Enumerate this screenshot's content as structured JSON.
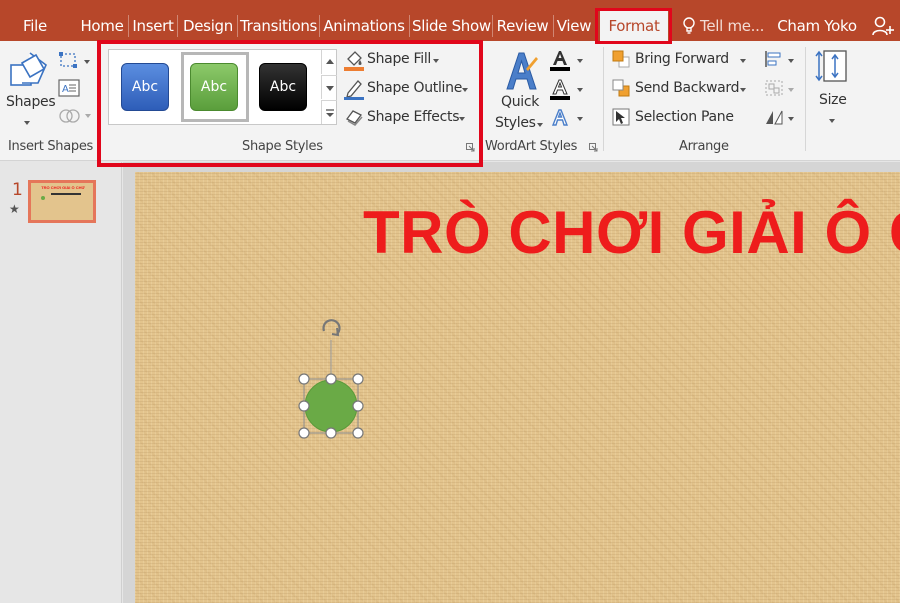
{
  "tabs": {
    "file": "File",
    "home": "Home",
    "insert": "Insert",
    "design": "Design",
    "transitions": "Transitions",
    "animations": "Animations",
    "slide_show": "Slide Show",
    "review": "Review",
    "view": "View",
    "format": "Format",
    "tell_me": "Tell me...",
    "user": "Cham Yoko"
  },
  "ribbon": {
    "insert_shapes": {
      "shapes_label": "Shapes",
      "group_label": "Insert Shapes"
    },
    "shape_styles": {
      "group_label": "Shape Styles",
      "thumbs": [
        "Abc",
        "Abc",
        "Abc"
      ],
      "fill": "Shape Fill",
      "outline": "Shape Outline",
      "effects": "Shape Effects"
    },
    "wordart": {
      "quick_styles_1": "Quick",
      "quick_styles_2": "Styles",
      "group_label": "WordArt Styles"
    },
    "arrange": {
      "bring_forward": "Bring Forward",
      "send_backward": "Send Backward",
      "selection_pane": "Selection Pane",
      "group_label": "Arrange"
    },
    "size": {
      "label": "Size"
    }
  },
  "slides_pane": {
    "slide_number": "1",
    "slide_title": "TRÒ CHƠI GIẢI Ô CHỮ"
  },
  "slide": {
    "title": "TRÒ CHƠI GIẢI Ô C"
  },
  "colors": {
    "accent": "#b7472a",
    "highlight": "#e1061b",
    "title": "#ee1c1c",
    "shape": "#6aaa46"
  }
}
